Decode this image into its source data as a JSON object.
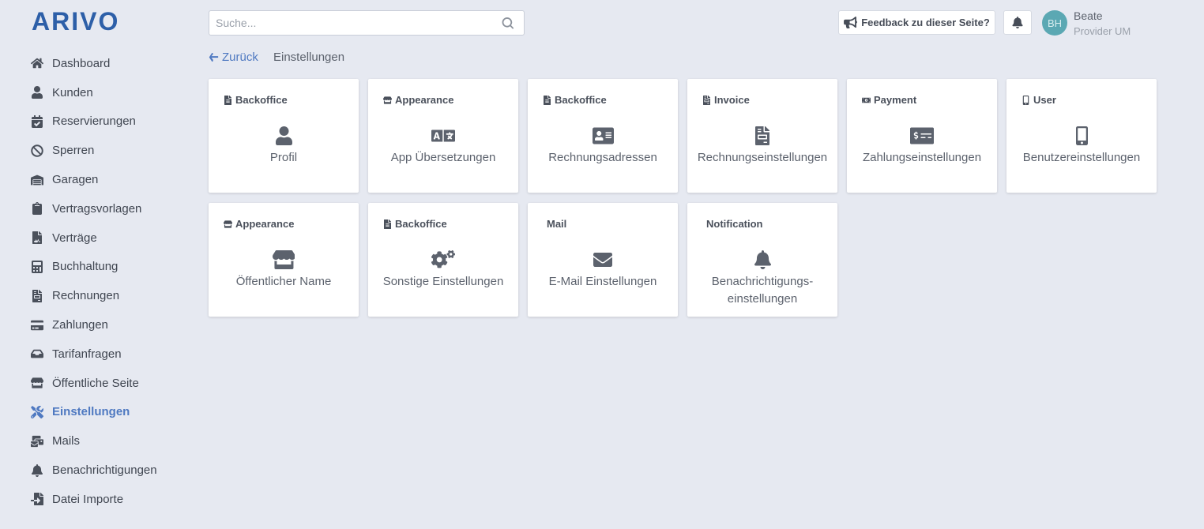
{
  "brand": {
    "logo_text": "ARIVO",
    "accent": "#4f79c1",
    "logo_color": "#2d5fa8"
  },
  "sidebar": {
    "items": [
      {
        "label": "Dashboard",
        "icon": "home-icon",
        "active": false
      },
      {
        "label": "Kunden",
        "icon": "user-icon",
        "active": false
      },
      {
        "label": "Reservierungen",
        "icon": "calendar-check-icon",
        "active": false
      },
      {
        "label": "Sperren",
        "icon": "ban-icon",
        "active": false
      },
      {
        "label": "Garagen",
        "icon": "warehouse-icon",
        "active": false
      },
      {
        "label": "Vertragsvorlagen",
        "icon": "clipboard-icon",
        "active": false
      },
      {
        "label": "Verträge",
        "icon": "file-signature-icon",
        "active": false
      },
      {
        "label": "Buchhaltung",
        "icon": "calculator-icon",
        "active": false
      },
      {
        "label": "Rechnungen",
        "icon": "file-invoice-icon",
        "active": false
      },
      {
        "label": "Zahlungen",
        "icon": "credit-card-icon",
        "active": false
      },
      {
        "label": "Tarifanfragen",
        "icon": "inbox-icon",
        "active": false
      },
      {
        "label": "Öffentliche Seite",
        "icon": "store-icon",
        "active": false
      },
      {
        "label": "Einstellungen",
        "icon": "tools-icon",
        "active": true
      },
      {
        "label": "Mails",
        "icon": "mail-bulk-icon",
        "active": false
      },
      {
        "label": "Benachrichtigungen",
        "icon": "bell-icon",
        "active": false
      },
      {
        "label": "Datei Importe",
        "icon": "file-import-icon",
        "active": false
      }
    ]
  },
  "header": {
    "search_placeholder": "Suche...",
    "feedback_label": "Feedback zu dieser Seite?",
    "user": {
      "initials": "BH",
      "name": "Beate",
      "role": "Provider UM"
    }
  },
  "breadcrumb": {
    "back_label": "Zurück",
    "current": "Einstellungen"
  },
  "cards": [
    {
      "category": "Backoffice",
      "cat_icon": "file-icon",
      "icon": "user-icon",
      "title": "Profil"
    },
    {
      "category": "Appearance",
      "cat_icon": "store-icon",
      "icon": "language-icon",
      "title": "App Übersetzungen"
    },
    {
      "category": "Backoffice",
      "cat_icon": "file-icon",
      "icon": "address-card-icon",
      "title": "Rechnungsadressen"
    },
    {
      "category": "Invoice",
      "cat_icon": "file-invoice-icon",
      "icon": "file-invoice-icon",
      "title": "Rechnungseinstellungen"
    },
    {
      "category": "Payment",
      "cat_icon": "money-bill-icon",
      "icon": "money-check-icon",
      "title": "Zahlungseinstellungen"
    },
    {
      "category": "User",
      "cat_icon": "mobile-icon",
      "icon": "mobile-icon",
      "title": "Benutzereinstellungen"
    },
    {
      "category": "Appearance",
      "cat_icon": "store-icon",
      "icon": "store-icon",
      "title": "Öffentlicher Name"
    },
    {
      "category": "Backoffice",
      "cat_icon": "file-icon",
      "icon": "cogs-icon",
      "title": "Sonstige Einstellungen"
    },
    {
      "category": "Mail",
      "cat_icon": "",
      "icon": "envelope-icon",
      "title": "E-Mail Einstellungen"
    },
    {
      "category": "Notification",
      "cat_icon": "",
      "icon": "bell-icon",
      "title": "Benachrichtigungs-\neinstellungen"
    }
  ]
}
